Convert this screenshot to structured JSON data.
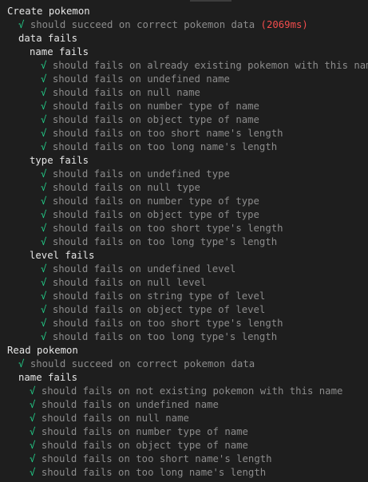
{
  "terminal": {
    "lines": [
      {
        "kind": "suite",
        "indent": 0,
        "text": "Create pokemon"
      },
      {
        "kind": "pass",
        "indent": 1,
        "check": "√",
        "text": "should succeed on correct pokemon data",
        "duration": "(2069ms)"
      },
      {
        "kind": "suite",
        "indent": 1,
        "text": "data fails"
      },
      {
        "kind": "suite",
        "indent": 2,
        "text": "name fails"
      },
      {
        "kind": "pass",
        "indent": 3,
        "check": "√",
        "text": "should fails on already existing pokemon with this name"
      },
      {
        "kind": "pass",
        "indent": 3,
        "check": "√",
        "text": "should fails on undefined name"
      },
      {
        "kind": "pass",
        "indent": 3,
        "check": "√",
        "text": "should fails on null name"
      },
      {
        "kind": "pass",
        "indent": 3,
        "check": "√",
        "text": "should fails on number type of name"
      },
      {
        "kind": "pass",
        "indent": 3,
        "check": "√",
        "text": "should fails on object type of name"
      },
      {
        "kind": "pass",
        "indent": 3,
        "check": "√",
        "text": "should fails on too short name's length"
      },
      {
        "kind": "pass",
        "indent": 3,
        "check": "√",
        "text": "should fails on too long name's length"
      },
      {
        "kind": "suite",
        "indent": 2,
        "text": "type fails"
      },
      {
        "kind": "pass",
        "indent": 3,
        "check": "√",
        "text": "should fails on undefined type"
      },
      {
        "kind": "pass",
        "indent": 3,
        "check": "√",
        "text": "should fails on null type"
      },
      {
        "kind": "pass",
        "indent": 3,
        "check": "√",
        "text": "should fails on number type of type"
      },
      {
        "kind": "pass",
        "indent": 3,
        "check": "√",
        "text": "should fails on object type of type"
      },
      {
        "kind": "pass",
        "indent": 3,
        "check": "√",
        "text": "should fails on too short type's length"
      },
      {
        "kind": "pass",
        "indent": 3,
        "check": "√",
        "text": "should fails on too long type's length"
      },
      {
        "kind": "suite",
        "indent": 2,
        "text": "level fails"
      },
      {
        "kind": "pass",
        "indent": 3,
        "check": "√",
        "text": "should fails on undefined level"
      },
      {
        "kind": "pass",
        "indent": 3,
        "check": "√",
        "text": "should fails on null level"
      },
      {
        "kind": "pass",
        "indent": 3,
        "check": "√",
        "text": "should fails on string type of level"
      },
      {
        "kind": "pass",
        "indent": 3,
        "check": "√",
        "text": "should fails on object type of level"
      },
      {
        "kind": "pass",
        "indent": 3,
        "check": "√",
        "text": "should fails on too short type's length"
      },
      {
        "kind": "pass",
        "indent": 3,
        "check": "√",
        "text": "should fails on too long type's length"
      },
      {
        "kind": "suite",
        "indent": 0,
        "text": "Read pokemon"
      },
      {
        "kind": "pass",
        "indent": 1,
        "check": "√",
        "text": "should succeed on correct pokemon data"
      },
      {
        "kind": "suite",
        "indent": 1,
        "text": "name fails"
      },
      {
        "kind": "pass",
        "indent": 2,
        "check": "√",
        "text": "should fails on not existing pokemon with this name"
      },
      {
        "kind": "pass",
        "indent": 2,
        "check": "√",
        "text": "should fails on undefined name"
      },
      {
        "kind": "pass",
        "indent": 2,
        "check": "√",
        "text": "should fails on null name"
      },
      {
        "kind": "pass",
        "indent": 2,
        "check": "√",
        "text": "should fails on number type of name"
      },
      {
        "kind": "pass",
        "indent": 2,
        "check": "√",
        "text": "should fails on object type of name"
      },
      {
        "kind": "pass",
        "indent": 2,
        "check": "√",
        "text": "should fails on too short name's length"
      },
      {
        "kind": "pass",
        "indent": 2,
        "check": "√",
        "text": "should fails on too long name's length"
      }
    ]
  },
  "colors": {
    "background": "#1e1e1e",
    "suite_text": "#e6e6e6",
    "check_mark": "#23d18b",
    "passed_text": "#8c8c8c",
    "duration_slow": "#f14c4c"
  }
}
